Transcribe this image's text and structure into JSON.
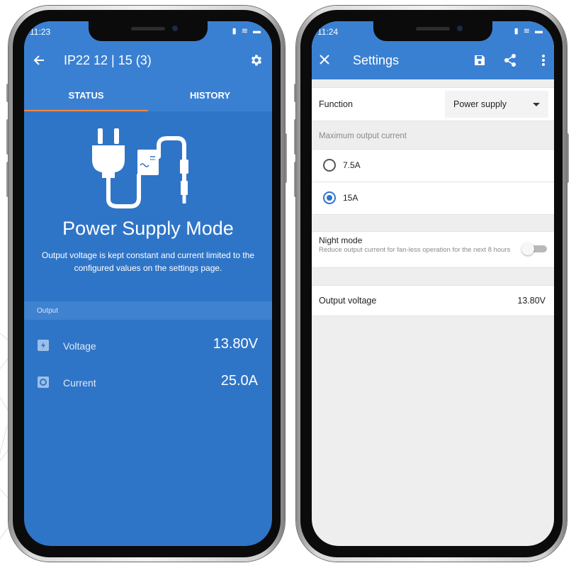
{
  "left_phone": {
    "status_bar": {
      "time": "11:23",
      "icons": "▮ ≋ ▬"
    },
    "app_bar": {
      "back_icon": "arrow-left-icon",
      "title": "IP22 12 | 15 (3)",
      "settings_icon": "gear-icon"
    },
    "tabs": [
      {
        "label": "STATUS",
        "active": true
      },
      {
        "label": "HISTORY",
        "active": false
      }
    ],
    "hero": {
      "icon": "power-plug-converter-icon",
      "title": "Power Supply Mode",
      "description": "Output voltage is kept constant and current limited to the configured values on the settings page."
    },
    "output": {
      "header": "Output",
      "rows": [
        {
          "icon": "battery-icon",
          "label": "Voltage",
          "value": "13.80V"
        },
        {
          "icon": "current-icon",
          "label": "Current",
          "value": "25.0A"
        }
      ]
    },
    "colors": {
      "primary": "#2f75c7",
      "appbar": "#3a80d2",
      "tab_indicator": "#f08a45"
    }
  },
  "right_phone": {
    "status_bar": {
      "time": "11:24",
      "icons": "▮ ≋ ▬"
    },
    "app_bar": {
      "close_icon": "close-icon",
      "title": "Settings",
      "save_icon": "save-icon",
      "share_icon": "share-icon",
      "more_icon": "more-vert-icon"
    },
    "function": {
      "label": "Function",
      "selected": "Power supply"
    },
    "max_current": {
      "section_label": "Maximum output current",
      "options": [
        {
          "label": "7.5A",
          "checked": false
        },
        {
          "label": "15A",
          "checked": true
        }
      ]
    },
    "night_mode": {
      "title": "Night mode",
      "description": "Reduce output current for fan-less operation for the next 8 hours",
      "enabled": false
    },
    "output_voltage": {
      "label": "Output voltage",
      "value": "13.80V"
    },
    "colors": {
      "background": "#eeeeee",
      "accent": "#2f75c7"
    }
  }
}
